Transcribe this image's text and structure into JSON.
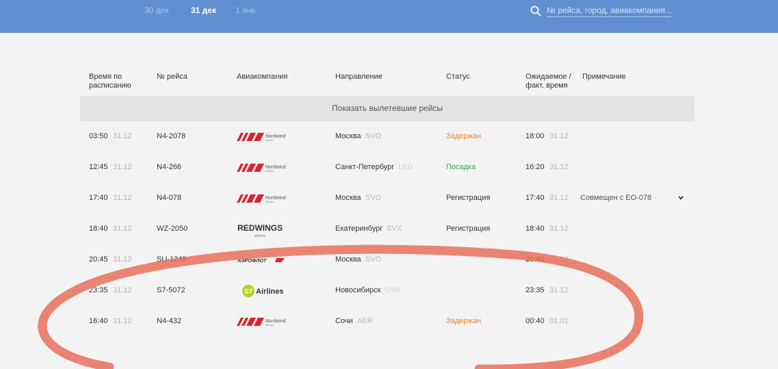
{
  "date_tabs": [
    {
      "label": "30 дек"
    },
    {
      "label": "31 дек"
    },
    {
      "label": "1 янв"
    }
  ],
  "search": {
    "placeholder": "№ рейса, город, авиакомпания..."
  },
  "columns": {
    "sched_time": "Время по расписанию",
    "flight": "№ рейса",
    "airline": "Авиакомпания",
    "direction": "Направление",
    "status": "Статус",
    "expected": "Ожидаемое / факт. время",
    "note": "Примечание"
  },
  "show_departed_label": "Показать вылетевшие рейсы",
  "logos": {
    "nordwind": "Nordwind",
    "nordwind_sub": "Airlines",
    "redwings_red": "RED",
    "redwings_wings": "WINGS",
    "redwings_sub": "airlines",
    "aeroflot": "АЭРОФЛОТ",
    "s7_badge": "S7",
    "s7_text": "Airlines"
  },
  "colors": {
    "header_bg": "#5f8fd0",
    "delayed": "#e0892c",
    "boarding": "#3fa14b",
    "annotation_ring": "#e8705a"
  },
  "flights": [
    {
      "time": "03:50",
      "date": "31.12",
      "flight": "N4-2078",
      "airline": "nordwind",
      "city": "Москва",
      "code": "SVO",
      "status": "Задержан",
      "status_type": "delayed",
      "exp_time": "18:00",
      "exp_date": "31.12",
      "note": ""
    },
    {
      "time": "12:45",
      "date": "31.12",
      "flight": "N4-266",
      "airline": "nordwind",
      "city": "Санкт-Петербург",
      "code": "LED",
      "status": "Посадка",
      "status_type": "boarding",
      "exp_time": "16:20",
      "exp_date": "31.12",
      "note": ""
    },
    {
      "time": "17:40",
      "date": "31.12",
      "flight": "N4-078",
      "airline": "nordwind",
      "city": "Москва",
      "code": "SVO",
      "status": "Регистрация",
      "status_type": "checkin",
      "exp_time": "17:40",
      "exp_date": "31.12",
      "note": "Совмещен с EO-078"
    },
    {
      "time": "18:40",
      "date": "31.12",
      "flight": "WZ-2050",
      "airline": "redwings",
      "city": "Екатеринбург",
      "code": "SVX",
      "status": "Регистрация",
      "status_type": "checkin",
      "exp_time": "18:40",
      "exp_date": "31.12",
      "note": ""
    },
    {
      "time": "20:45",
      "date": "31.12",
      "flight": "SU-1249",
      "airline": "aeroflot",
      "city": "Москва",
      "code": "SVO",
      "status": "",
      "status_type": "",
      "exp_time": "20:45",
      "exp_date": "31.12",
      "note": ""
    },
    {
      "time": "23:35",
      "date": "31.12",
      "flight": "S7-5072",
      "airline": "s7",
      "city": "Новосибирск",
      "code": "OVB",
      "status": "",
      "status_type": "",
      "exp_time": "23:35",
      "exp_date": "31.12",
      "note": ""
    },
    {
      "time": "16:40",
      "date": "31.12",
      "flight": "N4-432",
      "airline": "nordwind",
      "city": "Сочи",
      "code": "AER",
      "status": "Задержан",
      "status_type": "delayed",
      "exp_time": "00:40",
      "exp_date": "01.01",
      "note": ""
    }
  ]
}
